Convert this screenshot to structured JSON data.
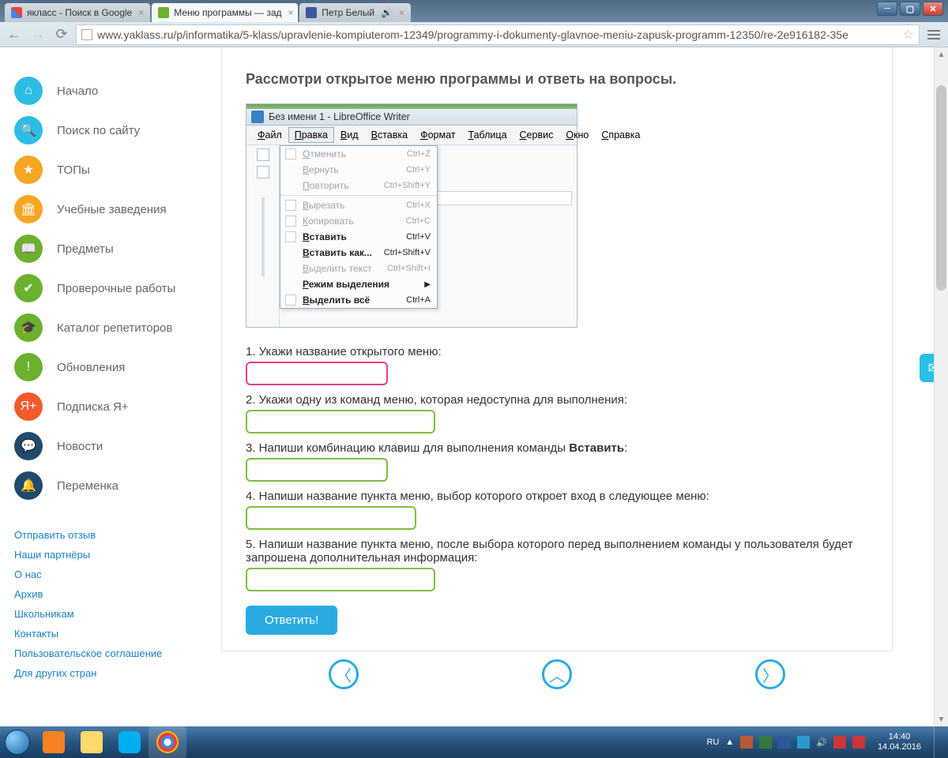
{
  "browser": {
    "tabs": [
      {
        "title": "якласс - Поиск в Google",
        "active": false
      },
      {
        "title": "Меню программы — зад",
        "active": true
      },
      {
        "title": "Петр Белый",
        "active": false,
        "audio": true
      }
    ],
    "url": "www.yaklass.ru/p/informatika/5-klass/upravlenie-kompiuterom-12349/programmy-i-dokumenty-glavnoe-meniu-zapusk-programm-12350/re-2e916182-35e"
  },
  "sidebar": {
    "items": [
      {
        "label": "Начало",
        "color": "#2dbde4",
        "icon": "home"
      },
      {
        "label": "Поиск по сайту",
        "color": "#2dbde4",
        "icon": "search"
      },
      {
        "label": "ТОПы",
        "color": "#f6a623",
        "icon": "star"
      },
      {
        "label": "Учебные заведения",
        "color": "#f6a623",
        "icon": "building"
      },
      {
        "label": "Предметы",
        "color": "#6bb12e",
        "icon": "book"
      },
      {
        "label": "Проверочные работы",
        "color": "#6bb12e",
        "icon": "check"
      },
      {
        "label": "Каталог репетиторов",
        "color": "#6bb12e",
        "icon": "grad"
      },
      {
        "label": "Обновления",
        "color": "#6bb12e",
        "icon": "alert"
      },
      {
        "label": "Подписка Я+",
        "color": "#f25a2b",
        "icon": "yplus"
      },
      {
        "label": "Новости",
        "color": "#1e4a6e",
        "icon": "chat"
      },
      {
        "label": "Переменка",
        "color": "#1e4a6e",
        "icon": "bell"
      }
    ],
    "footer": [
      "Отправить отзыв",
      "Наши партнёры",
      "О нас",
      "Архив",
      "Школьникам",
      "Контакты",
      "Пользовательское соглашение",
      "Для других стран"
    ]
  },
  "task": {
    "title": "Рассмотри открытое меню программы и ответь на вопросы.",
    "screenshot_caption": "Без имени 1 - LibreOffice Writer",
    "menubar": [
      "Файл",
      "Правка",
      "Вид",
      "Вставка",
      "Формат",
      "Таблица",
      "Сервис",
      "Окно",
      "Справка"
    ],
    "open_menu_index": 1,
    "font_size": "12",
    "dropdown": [
      {
        "label": "Отменить",
        "kbd": "Ctrl+Z",
        "disabled": true,
        "icon": true
      },
      {
        "label": "Вернуть",
        "kbd": "Ctrl+Y",
        "disabled": true
      },
      {
        "label": "Повторить",
        "kbd": "Ctrl+Shift+Y",
        "disabled": true
      },
      {
        "sep": true
      },
      {
        "label": "Вырезать",
        "kbd": "Ctrl+X",
        "disabled": true,
        "icon": true
      },
      {
        "label": "Копировать",
        "kbd": "Ctrl+C",
        "disabled": true,
        "icon": true
      },
      {
        "label": "Вставить",
        "kbd": "Ctrl+V",
        "icon": true,
        "bold": true
      },
      {
        "label": "Вставить как...",
        "kbd": "Ctrl+Shift+V",
        "bold": true
      },
      {
        "label": "Выделить текст",
        "kbd": "Ctrl+Shift+I",
        "disabled": true
      },
      {
        "label": "Режим выделения",
        "submenu": true,
        "bold": true
      },
      {
        "label": "Выделить всё",
        "kbd": "Ctrl+A",
        "icon": true,
        "bold": true
      }
    ],
    "questions": [
      {
        "n": "1.",
        "text": "Укажи название открытого меню:"
      },
      {
        "n": "2.",
        "text": "Укажи одну из команд меню, которая недоступна для выполнения:"
      },
      {
        "n": "3.",
        "text": "Напиши комбинацию клавиш для выполнения команды ",
        "bold": "Вставить",
        "after": ":"
      },
      {
        "n": "4.",
        "text": "Напиши название пункта меню, выбор которого откроет вход в следующее меню:"
      },
      {
        "n": "5.",
        "text": "Напиши название пункта меню, после выбора которого перед выполнением команды у пользователя будет запрошена дополнительная информация:"
      }
    ],
    "submit": "Ответить!"
  },
  "taskbar": {
    "lang": "RU",
    "time": "14:40",
    "date": "14.04.2016"
  }
}
